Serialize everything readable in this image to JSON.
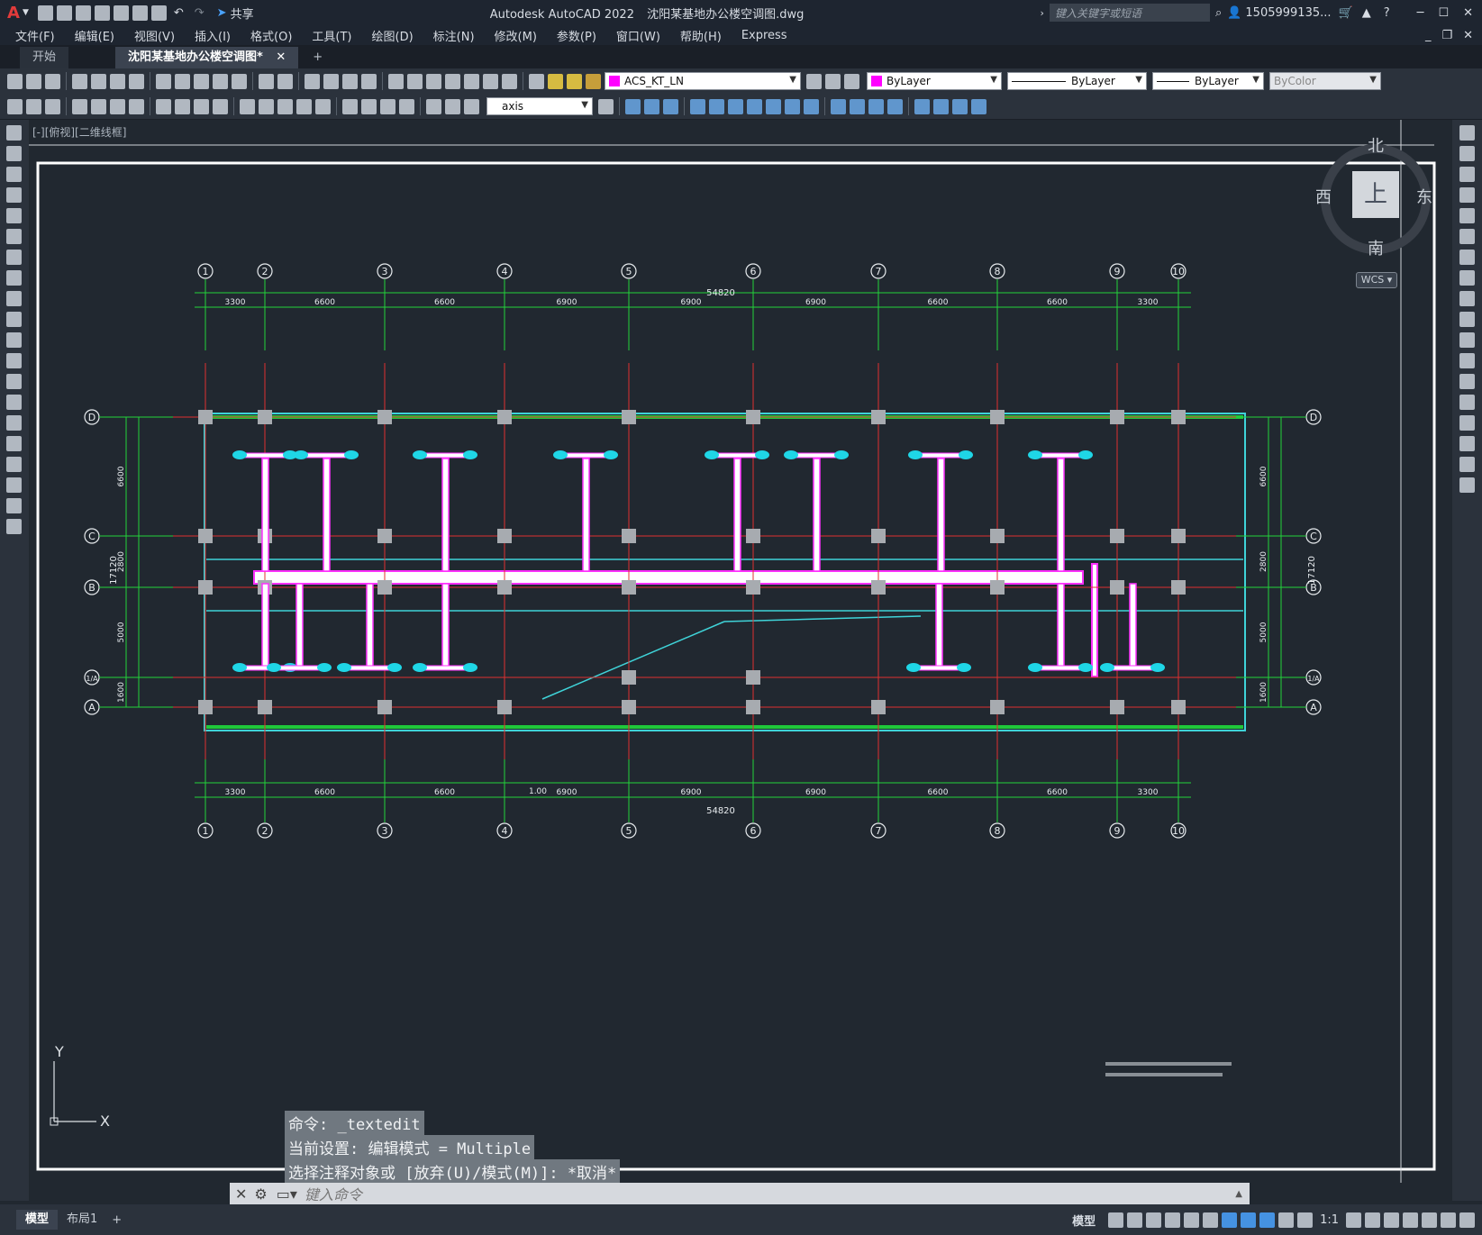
{
  "titlebar": {
    "app_title": "Autodesk AutoCAD 2022",
    "file_title": "沈阳某基地办公楼空调图.dwg",
    "share_label": "共享",
    "search_placeholder": "键入关键字或短语",
    "user": "1505999135..."
  },
  "menu": {
    "items": [
      {
        "label": "文件(F)"
      },
      {
        "label": "编辑(E)"
      },
      {
        "label": "视图(V)"
      },
      {
        "label": "插入(I)"
      },
      {
        "label": "格式(O)"
      },
      {
        "label": "工具(T)"
      },
      {
        "label": "绘图(D)"
      },
      {
        "label": "标注(N)"
      },
      {
        "label": "修改(M)"
      },
      {
        "label": "参数(P)"
      },
      {
        "label": "窗口(W)"
      },
      {
        "label": "帮助(H)"
      },
      {
        "label": "Express"
      }
    ]
  },
  "tabs": {
    "start": "开始",
    "active": "沈阳某基地办公楼空调图*"
  },
  "toolbar": {
    "layer_name": "ACS_KT_LN",
    "layer_color": "#ff00ff",
    "color_value": "ByLayer",
    "linetype_value": "ByLayer",
    "lineweight_value": "ByLayer",
    "plotstyle_value": "ByColor",
    "dimstyle_value": "axis"
  },
  "viewport": {
    "label": "[-][俯视][二维线框]",
    "compass": {
      "north": "北",
      "south": "南",
      "east": "东",
      "west": "西",
      "top": "上"
    },
    "wcs": "WCS"
  },
  "drawing": {
    "total_dim": "54820",
    "top_spans": [
      "3300",
      "6600",
      "6600",
      "6900",
      "6900",
      "6900",
      "6600",
      "6600",
      "3300"
    ],
    "bottom_spans": [
      "3300",
      "6600",
      "6600",
      "6900",
      "6900",
      "6900",
      "6600",
      "6600",
      "3300"
    ],
    "bottom_extra": "1.00",
    "col_axes": [
      "1",
      "2",
      "3",
      "4",
      "5",
      "6",
      "7",
      "8",
      "9",
      "10"
    ],
    "row_axes": [
      "D",
      "C",
      "B",
      "1/A",
      "A"
    ],
    "left_dims": [
      "6600",
      "2800",
      "5000",
      "1600"
    ],
    "left_total": "17120",
    "right_dims": [
      "6600",
      "2800",
      "5000",
      "1600"
    ],
    "right_total": "17120"
  },
  "command": {
    "history": [
      "命令: _textedit",
      "当前设置: 编辑模式 = Multiple",
      "选择注释对象或 [放弃(U)/模式(M)]: *取消*"
    ],
    "placeholder": "键入命令"
  },
  "ucs": {
    "x": "X",
    "y": "Y"
  },
  "status": {
    "model_tab": "模型",
    "layout_tab": "布局1",
    "model_label": "模型",
    "scale": "1:1"
  }
}
